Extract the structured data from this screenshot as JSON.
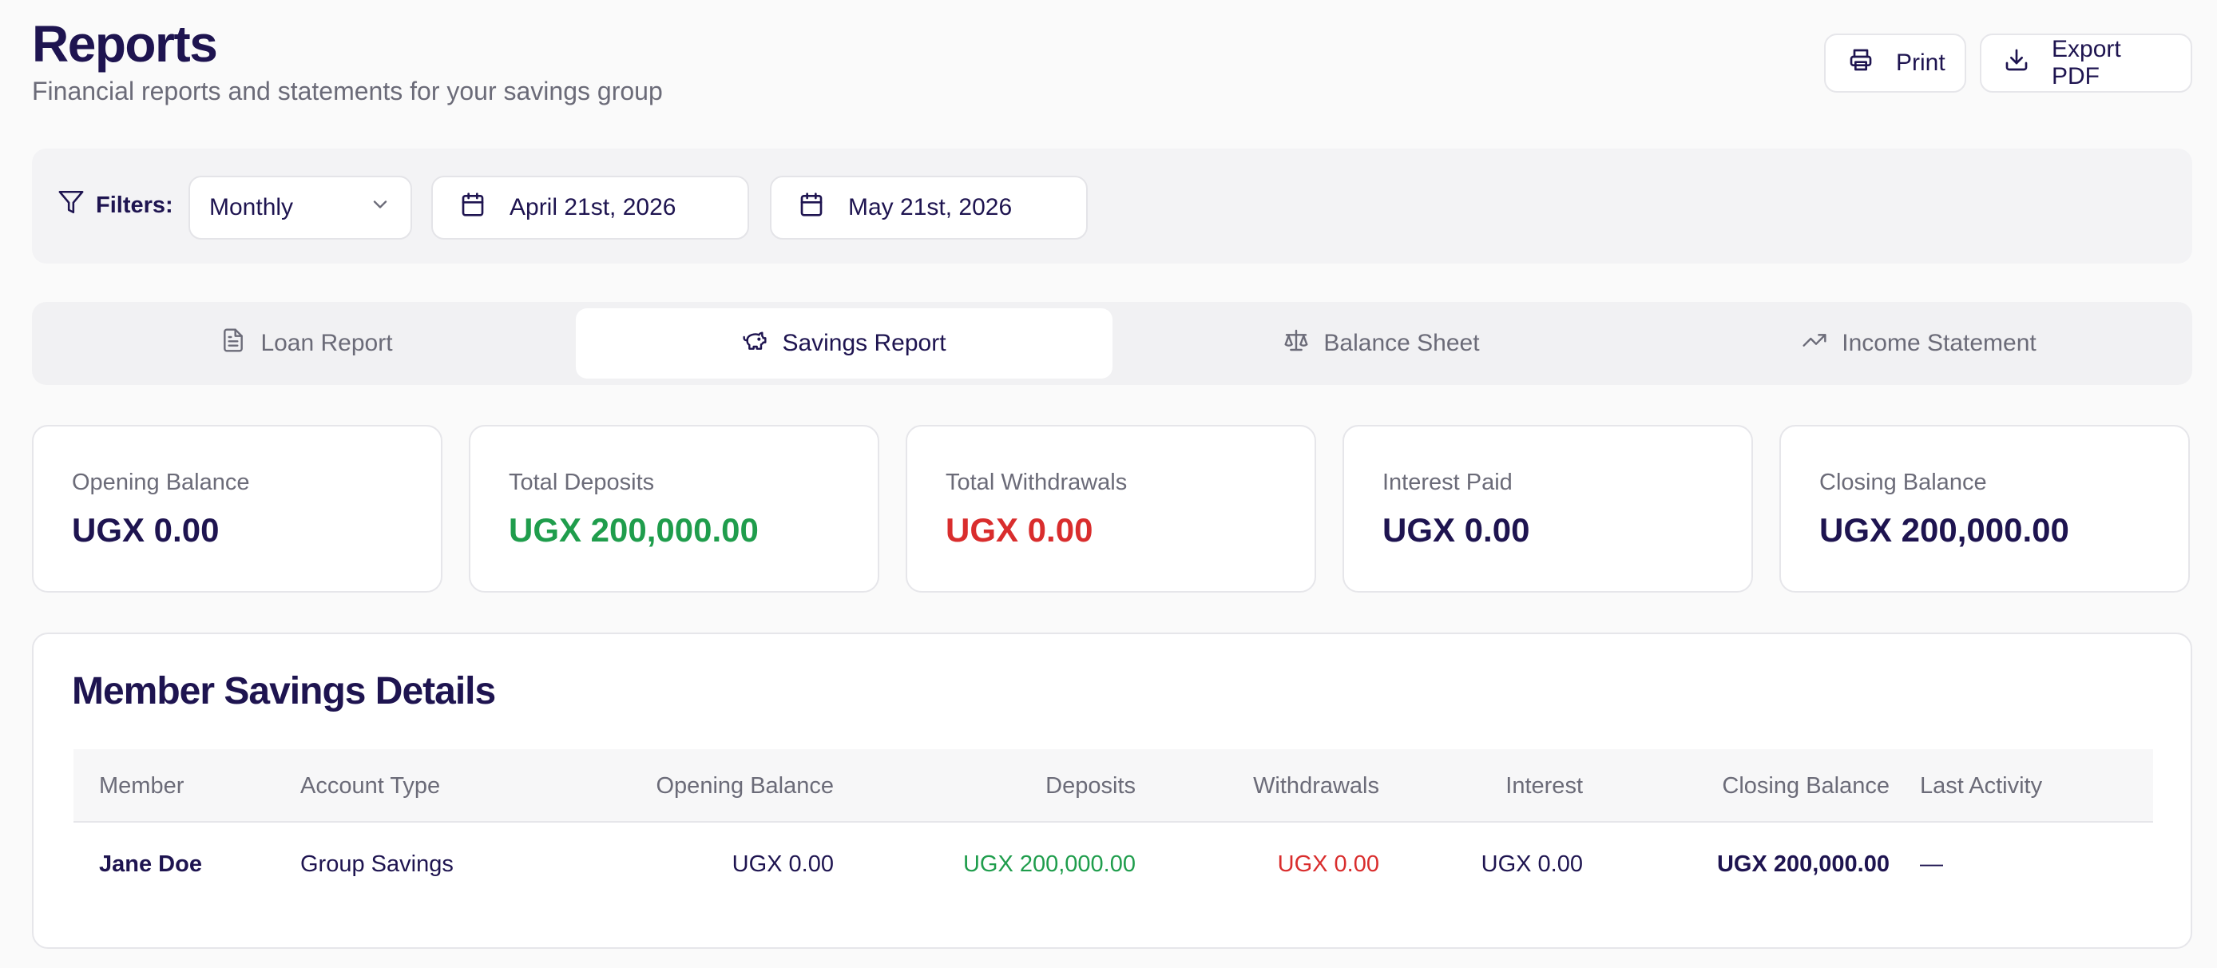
{
  "header": {
    "title": "Reports",
    "subtitle": "Financial reports and statements for your savings group",
    "print_label": "Print",
    "export_label": "Export PDF"
  },
  "filters": {
    "label": "Filters:",
    "period": "Monthly",
    "date_from": "April 21st, 2026",
    "date_to": "May 21st, 2026"
  },
  "tabs": [
    {
      "label": "Loan Report",
      "icon": "file-text-icon",
      "active": false
    },
    {
      "label": "Savings Report",
      "icon": "piggy-bank-icon",
      "active": true
    },
    {
      "label": "Balance Sheet",
      "icon": "scale-icon",
      "active": false
    },
    {
      "label": "Income Statement",
      "icon": "trending-up-icon",
      "active": false
    }
  ],
  "summary": [
    {
      "label": "Opening Balance",
      "value": "UGX 0.00",
      "tone": "default"
    },
    {
      "label": "Total Deposits",
      "value": "UGX 200,000.00",
      "tone": "positive"
    },
    {
      "label": "Total Withdrawals",
      "value": "UGX 0.00",
      "tone": "negative"
    },
    {
      "label": "Interest Paid",
      "value": "UGX 0.00",
      "tone": "default"
    },
    {
      "label": "Closing Balance",
      "value": "UGX 200,000.00",
      "tone": "default"
    }
  ],
  "colors": {
    "primary_text": "#1e1450",
    "positive": "#1f9d4c",
    "negative": "#d92d2d",
    "muted": "#6b6b78"
  },
  "table": {
    "title": "Member Savings Details",
    "columns": [
      "Member",
      "Account Type",
      "Opening Balance",
      "Deposits",
      "Withdrawals",
      "Interest",
      "Closing Balance",
      "Last Activity"
    ],
    "rows": [
      {
        "member": "Jane Doe",
        "account_type": "Group Savings",
        "opening": "UGX 0.00",
        "deposits": "UGX 200,000.00",
        "withdrawals": "UGX 0.00",
        "interest": "UGX 0.00",
        "closing": "UGX 200,000.00",
        "last_activity": "—"
      }
    ]
  }
}
